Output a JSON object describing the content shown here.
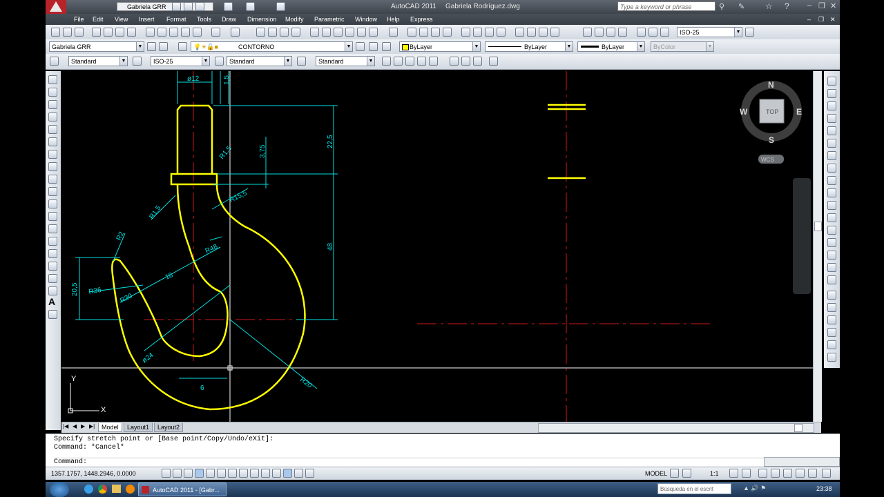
{
  "app": {
    "title": "AutoCAD 2011",
    "document": "Gabriela Rodríguez.dwg",
    "workspace": "Gabriela GRR",
    "search_placeholder": "Type a keyword or phrase"
  },
  "menus": [
    "File",
    "Edit",
    "View",
    "Insert",
    "Format",
    "Tools",
    "Draw",
    "Dimension",
    "Modify",
    "Parametric",
    "Window",
    "Help",
    "Express"
  ],
  "toolbars": {
    "dimstyle_right": "ISO-25",
    "workspace_combo": "Gabriela GRR",
    "layer_combo": "CONTORNO",
    "color_combo": "ByLayer",
    "linetype_combo": "ByLayer",
    "lineweight_combo": "ByLayer",
    "plotstyle_combo": "ByColor",
    "textstyle_combo": "Standard",
    "dimstyle_combo": "ISO-25",
    "tablestyle_combo": "Standard",
    "mleaderstyle_combo": "Standard"
  },
  "viewcube": {
    "north": "N",
    "south": "S",
    "east": "E",
    "west": "W",
    "face": "TOP",
    "ucs": "WCS"
  },
  "dimensions": {
    "d12": "ø12",
    "d15": "1,5",
    "d225": "22,5",
    "d375": "3,75",
    "r15a": "R1,5",
    "r155": "R15,5",
    "r15b": "R1,5",
    "r2": "R2",
    "r48": "R48",
    "d18": "18",
    "d205": "20,5",
    "r36": "R36",
    "r30": "R30",
    "d48": "48",
    "d24": "ø24",
    "r20": "R20",
    "d6": "6"
  },
  "ucs_icon": {
    "x": "X",
    "y": "Y"
  },
  "tabs": [
    "Model",
    "Layout1",
    "Layout2"
  ],
  "command": {
    "line1": "Specify stretch point or [Base point/Copy/Undo/eXit]:",
    "line2": "Command: *Cancel*",
    "prompt": "Command:"
  },
  "status": {
    "coords": "1357.1757, 1448.2946, 0.0000",
    "space": "MODEL",
    "scale": "1:1",
    "time": "23:38"
  },
  "taskbar": {
    "task": "AutoCAD 2011 - [Gabr...",
    "search": "Búsqueda en el escrit"
  }
}
